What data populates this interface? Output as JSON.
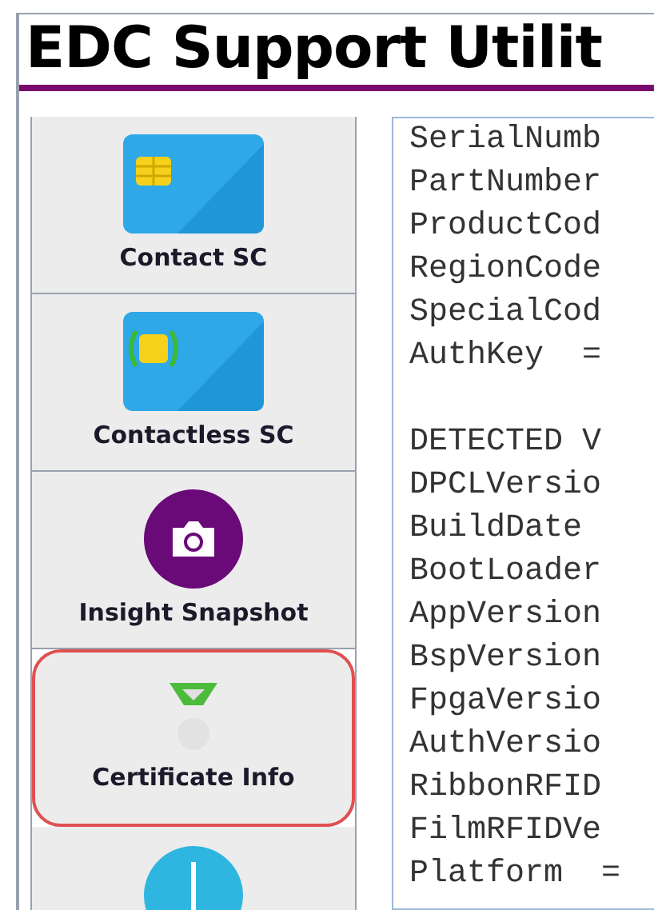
{
  "title": "EDC Support Utilit",
  "sidebar": {
    "items": [
      {
        "kind": "contact-card",
        "label": "Contact SC",
        "highlighted": false
      },
      {
        "kind": "contactless-card",
        "label": "Contactless SC",
        "highlighted": false
      },
      {
        "kind": "camera",
        "label": "Insight Snapshot",
        "highlighted": false
      },
      {
        "kind": "certificate",
        "label": "Certificate Info",
        "highlighted": true
      },
      {
        "kind": "info",
        "highlighted": false
      }
    ]
  },
  "output_blocks": [
    {
      "lines": [
        "SerialNumb",
        "PartNumber",
        "ProductCod",
        "RegionCode",
        "SpecialCod",
        "AuthKey  ="
      ]
    },
    {
      "lines": [
        "DETECTED V",
        "DPCLVersio",
        "BuildDate",
        "BootLoader",
        "AppVersion",
        "BspVersion",
        "FpgaVersio",
        "AuthVersio",
        "RibbonRFID",
        "FilmRFIDVe",
        "Platform  ="
      ]
    }
  ]
}
